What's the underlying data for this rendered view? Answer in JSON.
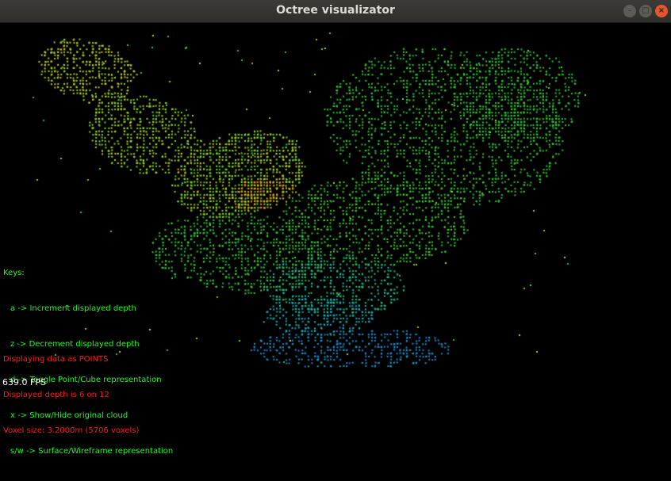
{
  "window": {
    "title": "Octree visualizator",
    "minimize_glyph": "–",
    "maximize_glyph": "□",
    "close_glyph": "×"
  },
  "keys": {
    "heading": "Keys:",
    "lines": [
      "a -> Increment displayed depth",
      "z -> Decrement displayed depth",
      "d -> Toggle Point/Cube representation",
      "x -> Show/Hide original cloud",
      "s/w -> Surface/Wireframe representation"
    ]
  },
  "status": {
    "mode": "Displaying data as POINTS",
    "depth": "Displayed depth is 6 on 12",
    "voxel": "Voxel size: 3.2000m (5706 voxels)"
  },
  "fps": "639.0 FPS",
  "colors": {
    "keys_text": "#19ff19",
    "status_text": "#ff1a1a",
    "fps_text": "#ffffff",
    "background": "#000000",
    "titlebar": "#3c3b37",
    "close_button": "#e4572c"
  }
}
